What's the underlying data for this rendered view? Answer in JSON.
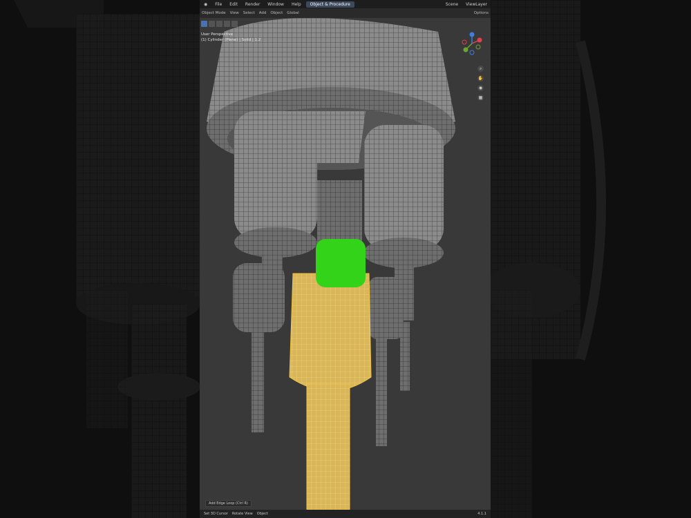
{
  "menu": [
    "File",
    "Edit",
    "Render",
    "Window",
    "Help"
  ],
  "workspace_tab": "Object & Procedure",
  "top_right": {
    "scene": "Scene",
    "view_layer": "ViewLayer"
  },
  "header_tools": [
    "Object Mode",
    "View",
    "Select",
    "Add",
    "Object",
    "Global",
    "Options"
  ],
  "viewport_info": {
    "line1": "User Perspective",
    "line2": "(1) Cylinder (Plane) | Solid | 1.2"
  },
  "popup": "Add Edge Loop (Ctrl R)",
  "status": {
    "item1": "Set 3D Cursor",
    "item2": "Rotate View",
    "item3": "Object",
    "version": "4.1.1"
  },
  "colors": {
    "background": "#171717",
    "viewport": "#393939",
    "selection": "#e8b83a",
    "green_overlay": "#33d31a",
    "accent": "#4772b3"
  }
}
